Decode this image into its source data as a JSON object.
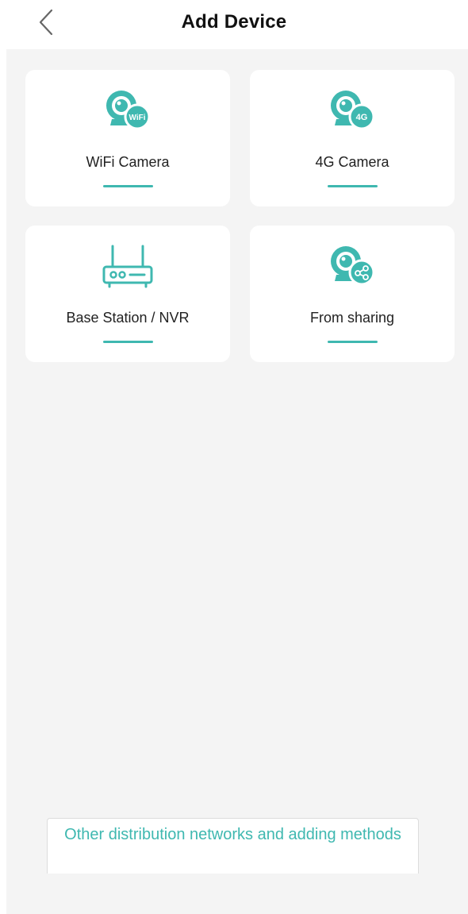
{
  "header": {
    "title": "Add Device",
    "back_icon": "chevron-left-icon"
  },
  "colors": {
    "accent": "#3fb8b0",
    "background": "#f4f4f4",
    "card": "#ffffff"
  },
  "devices": [
    {
      "label": "WiFi Camera",
      "icon": "wifi-camera-icon",
      "badge": "WiFi"
    },
    {
      "label": "4G Camera",
      "icon": "4g-camera-icon",
      "badge": "4G"
    },
    {
      "label": "Base Station / NVR",
      "icon": "base-station-icon"
    },
    {
      "label": "From sharing",
      "icon": "shared-camera-icon"
    }
  ],
  "footer": {
    "other_methods_label": "Other distribution networks and adding methods"
  }
}
